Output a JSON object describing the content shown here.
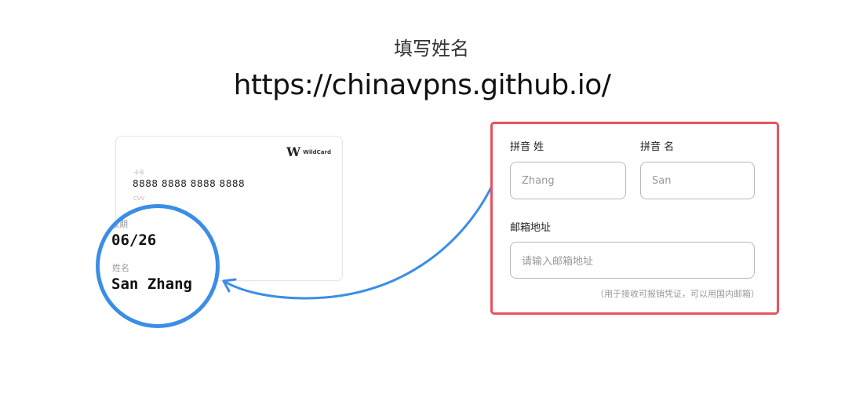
{
  "header": {
    "title": "填写姓名",
    "url": "https://chinavpns.github.io/"
  },
  "card": {
    "brand_mark": "W",
    "brand_name": "WildCard",
    "card_number_label": "卡号",
    "card_number": "8888 8888 8888 8888",
    "cvv_label": "CVV"
  },
  "zoom": {
    "expiry_label": "有效期",
    "expiry_value": "06/26",
    "name_label": "姓名",
    "name_value": "San Zhang"
  },
  "form": {
    "surname_label": "拼音 姓",
    "given_name_label": "拼音 名",
    "surname_placeholder": "Zhang",
    "given_name_placeholder": "San",
    "email_label": "邮箱地址",
    "email_placeholder": "请输入邮箱地址",
    "email_hint": "（用于接收可报销凭证，可以用国内邮箱）"
  },
  "colors": {
    "highlight_border": "#e8525f",
    "zoom_ring": "#3a8ee6",
    "arrow": "#3a8ee6"
  }
}
